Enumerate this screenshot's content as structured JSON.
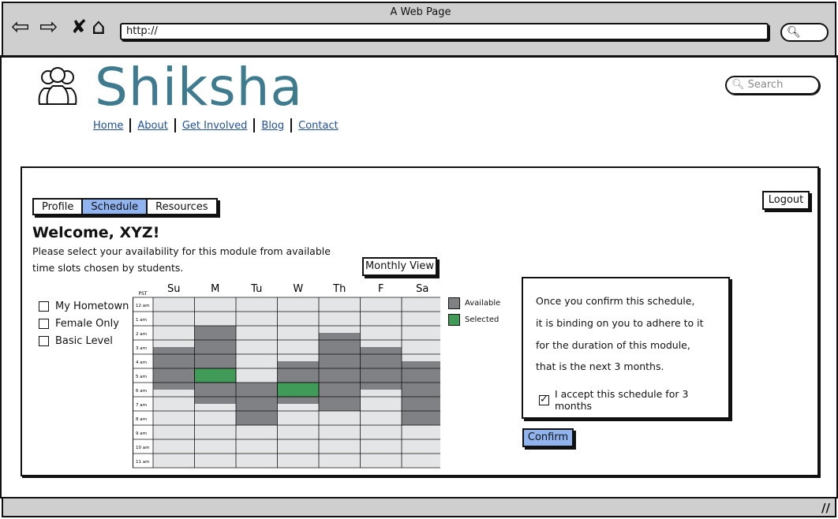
{
  "browser": {
    "window_title": "A Web Page",
    "url": "http://",
    "icons": {
      "back": "back-arrow-icon",
      "forward": "forward-arrow-icon",
      "stop": "close-icon",
      "home": "home-icon",
      "search": "search-icon"
    }
  },
  "site": {
    "brand": "Shiksha",
    "nav": [
      "Home",
      "About",
      "Get Involved",
      "Blog",
      "Contact"
    ],
    "search_placeholder": "Search",
    "brand_color": "#3e7b8f"
  },
  "tabs": {
    "items": [
      "Profile",
      "Schedule",
      "Resources"
    ],
    "active": "Schedule"
  },
  "logout_label": "Logout",
  "welcome": "Welcome, XYZ!",
  "instructions": [
    "Please select your availability for this module from available",
    "time slots chosen by students."
  ],
  "monthly_view_label": "Monthly View",
  "filters": [
    {
      "label": "My Hometown",
      "checked": false
    },
    {
      "label": "Female Only",
      "checked": false
    },
    {
      "label": "Basic Level",
      "checked": false
    }
  ],
  "calendar": {
    "timezone": "PST",
    "days": [
      "Su",
      "M",
      "Tu",
      "W",
      "Th",
      "F",
      "Sa"
    ],
    "hours": [
      "12 am",
      "1 am",
      "2 am",
      "3 am",
      "4 am",
      "5 am",
      "6 am",
      "7 am",
      "8 am",
      "9 am",
      "10 am",
      "11 am"
    ],
    "available": [
      {
        "day": 0,
        "from": 3.5,
        "to": 6.5
      },
      {
        "day": 1,
        "from": 2.0,
        "to": 7.5
      },
      {
        "day": 2,
        "from": 6.0,
        "to": 9.0
      },
      {
        "day": 3,
        "from": 4.5,
        "to": 7.5
      },
      {
        "day": 4,
        "from": 2.5,
        "to": 8.0
      },
      {
        "day": 5,
        "from": 3.5,
        "to": 6.5
      },
      {
        "day": 6,
        "from": 4.5,
        "to": 9.0
      }
    ],
    "selected": [
      {
        "day": 1,
        "from": 5.0,
        "to": 6.0
      },
      {
        "day": 3,
        "from": 6.0,
        "to": 7.0
      }
    ],
    "colors": {
      "empty": "#e4e5e6",
      "available": "#808184",
      "selected": "#3f9b57"
    }
  },
  "legend": [
    {
      "label": "Available",
      "color": "#808184"
    },
    {
      "label": "Selected",
      "color": "#3f9b57"
    }
  ],
  "confirm": {
    "lines": [
      "Once you confirm this schedule,",
      "it is binding on you to adhere to it",
      "for the duration of this module,",
      "that is the next 3 months."
    ],
    "accept_label": "I accept this schedule for 3 months",
    "accept_checked": true,
    "button_label": "Confirm"
  }
}
